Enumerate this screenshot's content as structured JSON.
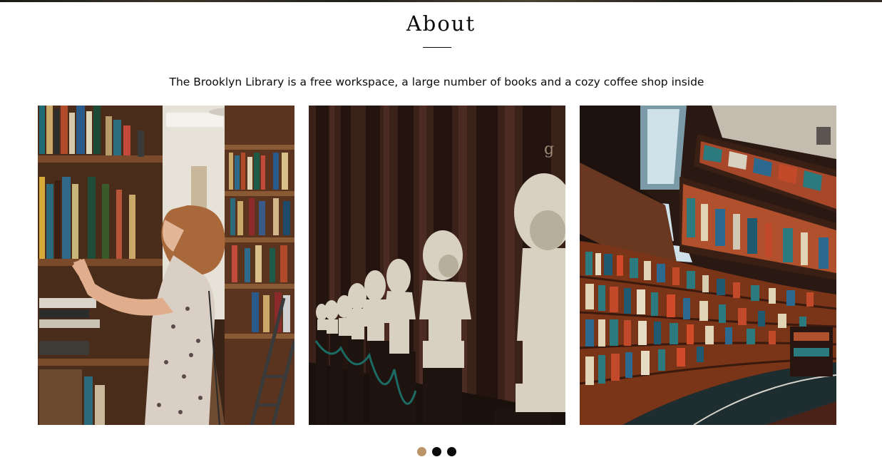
{
  "section": {
    "title": "About",
    "description": "The Brooklyn Library is a free workspace, a large number of books and a cozy coffee shop inside"
  },
  "gallery": {
    "slides": [
      {
        "subject": "woman browsing library bookshelves"
      },
      {
        "subject": "row of marble busts in dark library hall"
      },
      {
        "subject": "curved multi-level library bookshelves"
      }
    ]
  },
  "slider": {
    "dots": 3,
    "active_index": 0,
    "active_color": "#bb9468",
    "inactive_color": "#0b0b0b"
  }
}
